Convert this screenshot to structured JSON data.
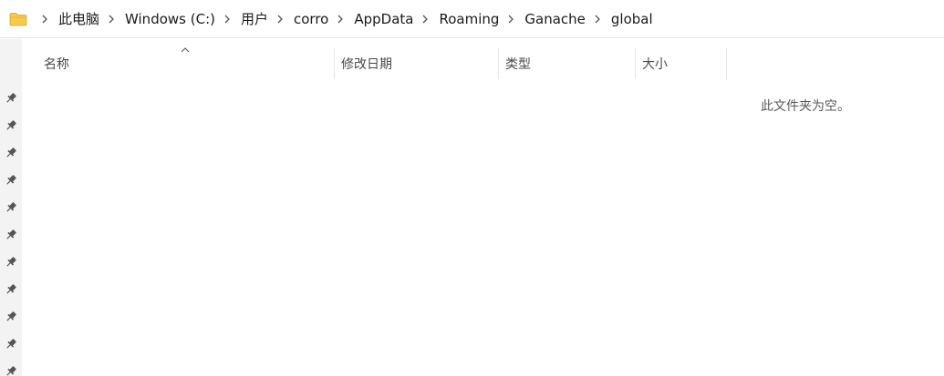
{
  "breadcrumb": {
    "items": [
      "此电脑",
      "Windows (C:)",
      "用户",
      "corro",
      "AppData",
      "Roaming",
      "Ganache",
      "global"
    ]
  },
  "columns": {
    "name": "名称",
    "modified": "修改日期",
    "type": "类型",
    "size": "大小"
  },
  "empty_message": "此文件夹为空。",
  "icons": {
    "location": "folder-icon",
    "separator": "chevron-right-icon",
    "sort": "sort-ascending-icon",
    "quick_access": "pin-icon"
  },
  "colors": {
    "folder": "#f7c94b",
    "pin_strip": "#f3f3f3"
  }
}
